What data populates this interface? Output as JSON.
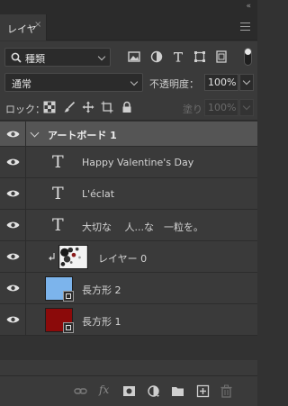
{
  "panel": {
    "tab_label": "レイヤー",
    "close_glyph": "×",
    "collapse_glyph": "«"
  },
  "filter": {
    "kind_label": "種類",
    "icons": [
      "image-filter-icon",
      "adjustment-filter-icon",
      "type-filter-icon",
      "shape-filter-icon",
      "smart-object-filter-icon"
    ],
    "filter_on": true
  },
  "blend": {
    "mode": "通常",
    "opacity_label": "不透明度：",
    "opacity_value": "100%"
  },
  "lock": {
    "label": "ロック：",
    "icons": [
      "lock-transparent-pixels-icon",
      "lock-image-pixels-icon",
      "lock-position-icon",
      "lock-artboard-icon",
      "lock-all-icon"
    ],
    "fill_label": "塗り：",
    "fill_value": "100%"
  },
  "layers": [
    {
      "type": "artboard",
      "name": "アートボード 1",
      "visible": true
    },
    {
      "type": "text",
      "name": "Happy Valentine's Day",
      "visible": true
    },
    {
      "type": "text",
      "name": "L'éclat",
      "visible": true
    },
    {
      "type": "text",
      "name": "大切な　 人...な　一粒を。",
      "visible": true
    },
    {
      "type": "image",
      "name": "レイヤー 0",
      "visible": true,
      "clipped": true
    },
    {
      "type": "shape",
      "name": "長方形 2",
      "visible": true,
      "fill": "#7cb4ec"
    },
    {
      "type": "shape",
      "name": "長方形 1",
      "visible": true,
      "fill": "#8b0a0a"
    }
  ],
  "footer_icons": [
    "link-layers-icon",
    "fx-icon",
    "add-mask-icon",
    "adjustment-layer-icon",
    "new-group-icon",
    "new-layer-icon",
    "delete-layer-icon"
  ],
  "colors": {
    "panel_bg": "#3a3a3a",
    "artboard_row_bg": "#555555",
    "rect2": "#7cb4ec",
    "rect1": "#8b0a0a"
  }
}
